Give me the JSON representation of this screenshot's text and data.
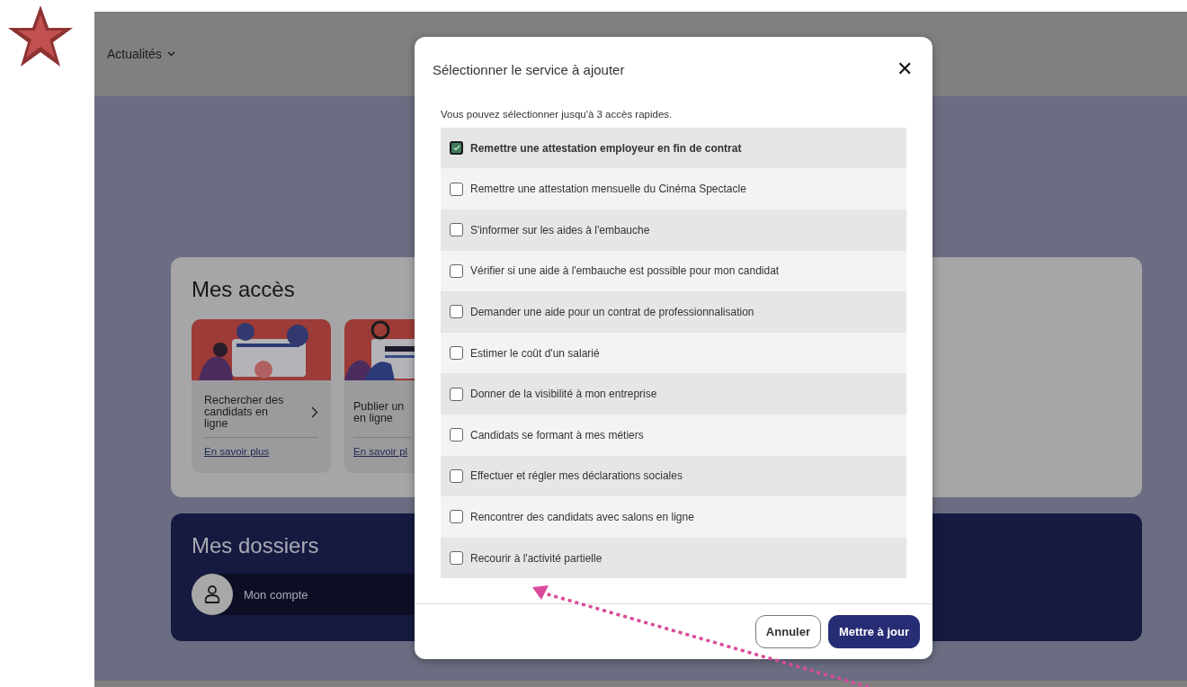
{
  "header": {
    "nav_item": "Actualités"
  },
  "access": {
    "title": "Mes accès",
    "cards": [
      {
        "title_lines": [
          "Rechercher des",
          "candidats en",
          "ligne"
        ],
        "link": "En savoir plus",
        "chevron": true
      },
      {
        "title_lines": [
          "Publier un",
          "en ligne"
        ],
        "link": "En savoir pl",
        "chevron": false
      }
    ]
  },
  "dossiers": {
    "title": "Mes dossiers",
    "items": [
      {
        "label": "Mon compte"
      }
    ]
  },
  "modal": {
    "title": "Sélectionner le service à ajouter",
    "close": "✕",
    "intro": "Vous pouvez sélectionner jusqu'à 3 accès rapides.",
    "options": [
      {
        "label": "Remettre une attestation employeur en fin de contrat",
        "checked": true
      },
      {
        "label": "Remettre une attestation mensuelle du Cinéma Spectacle",
        "checked": false
      },
      {
        "label": "S'informer sur les aides à l'embauche",
        "checked": false
      },
      {
        "label": "Vérifier si une aide à l'embauche est possible pour mon candidat",
        "checked": false
      },
      {
        "label": "Demander une aide pour un contrat de professionnalisation",
        "checked": false
      },
      {
        "label": "Estimer le coût d'un salarié",
        "checked": false
      },
      {
        "label": "Donner de la visibilité à mon entreprise",
        "checked": false
      },
      {
        "label": "Candidats se formant à mes métiers",
        "checked": false
      },
      {
        "label": "Effectuer et régler mes déclarations sociales",
        "checked": false
      },
      {
        "label": "Rencontrer des candidats avec salons en ligne",
        "checked": false
      },
      {
        "label": "Recourir à l'activité partielle",
        "checked": false
      }
    ],
    "buttons": [
      {
        "label": "Annuler",
        "kind": "secondary"
      },
      {
        "label": "Mettre à jour",
        "kind": "primary"
      }
    ]
  }
}
